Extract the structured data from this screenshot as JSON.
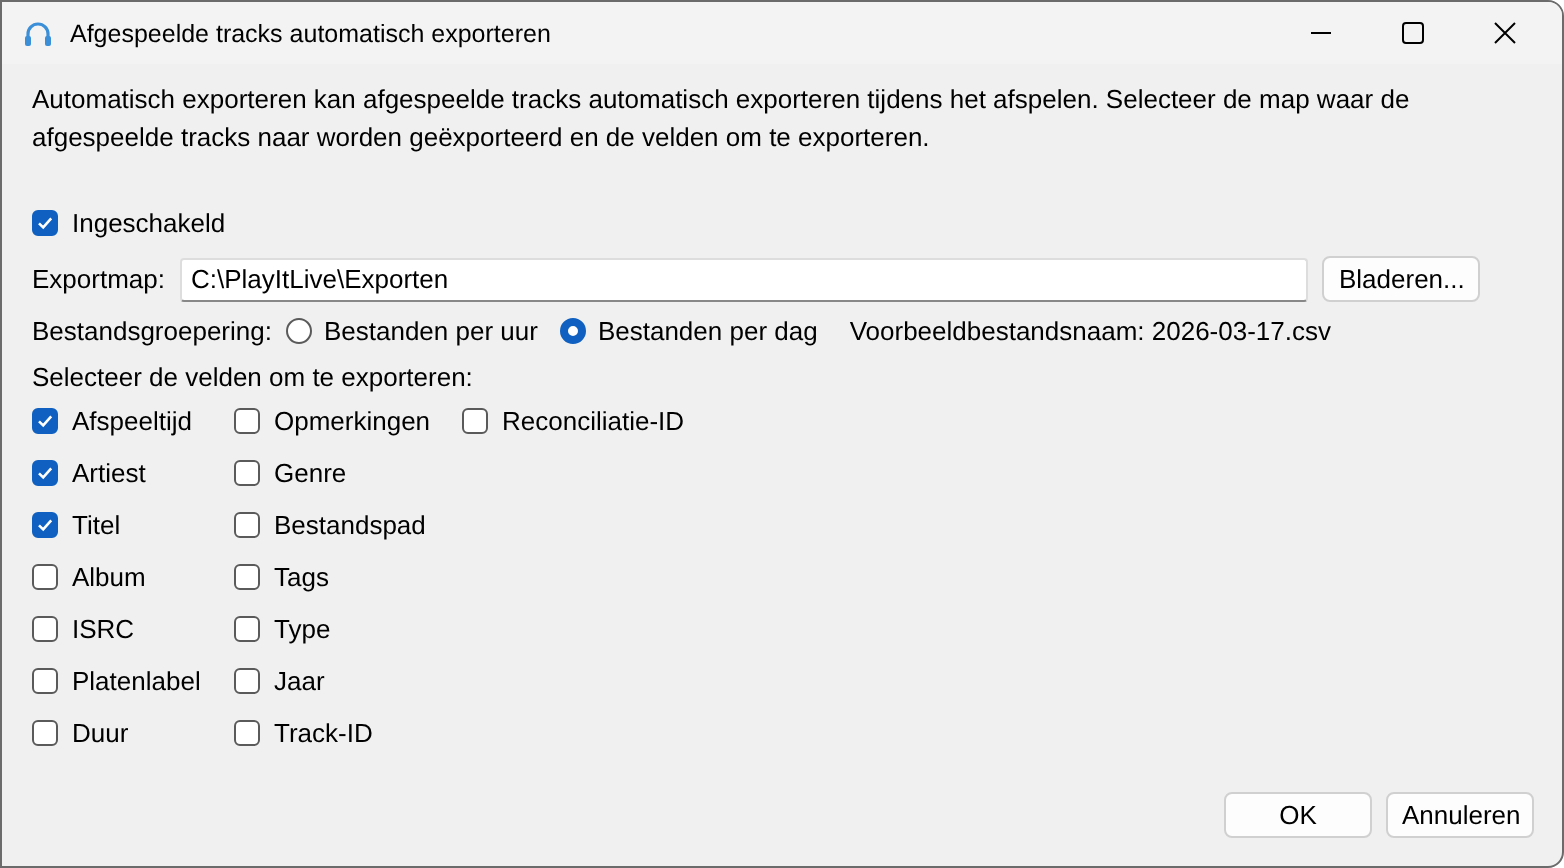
{
  "window": {
    "title": "Afgespeelde tracks automatisch exporteren"
  },
  "description": "Automatisch exporteren kan afgespeelde tracks automatisch exporteren tijdens het afspelen. Selecteer de map waar de afgespeelde tracks naar worden geëxporteerd en de velden om te exporteren.",
  "enabled": {
    "label": "Ingeschakeld",
    "checked": true
  },
  "export_folder": {
    "label": "Exportmap:",
    "value": "C:\\PlayItLive\\Exporten",
    "button": "Bladeren..."
  },
  "grouping": {
    "label": "Bestandsgroepering:",
    "options": [
      {
        "label": "Bestanden per uur",
        "selected": false
      },
      {
        "label": "Bestanden per dag",
        "selected": true
      }
    ],
    "example": "Voorbeeldbestandsnaam: 2026-03-17.csv"
  },
  "fields_label": "Selecteer de velden om te exporteren:",
  "field_columns": [
    [
      {
        "label": "Afspeeltijd",
        "checked": true
      },
      {
        "label": "Artiest",
        "checked": true
      },
      {
        "label": "Titel",
        "checked": true
      },
      {
        "label": "Album",
        "checked": false
      },
      {
        "label": "ISRC",
        "checked": false
      },
      {
        "label": "Platenlabel",
        "checked": false
      },
      {
        "label": "Duur",
        "checked": false
      }
    ],
    [
      {
        "label": "Opmerkingen",
        "checked": false
      },
      {
        "label": "Genre",
        "checked": false
      },
      {
        "label": "Bestandspad",
        "checked": false
      },
      {
        "label": "Tags",
        "checked": false
      },
      {
        "label": "Type",
        "checked": false
      },
      {
        "label": "Jaar",
        "checked": false
      },
      {
        "label": "Track-ID",
        "checked": false
      }
    ],
    [
      {
        "label": "Reconciliatie-ID",
        "checked": false
      }
    ]
  ],
  "buttons": [
    "OK",
    "Annuleren"
  ]
}
